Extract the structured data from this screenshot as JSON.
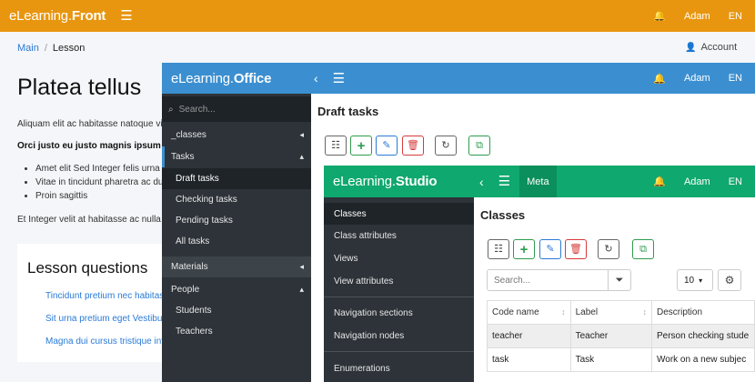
{
  "front": {
    "brand_light": "eLearning.",
    "brand_bold": "Front",
    "user": "Adam",
    "lang": "EN",
    "breadcrumb": {
      "main": "Main",
      "separator": "/",
      "current": "Lesson"
    },
    "account": "Account",
    "title": "Platea tellus",
    "paragraph1": "Aliquam elit ac habitasse natoque vi",
    "paragraph2": "Orci justo eu justo magnis ipsum ju",
    "bullets": [
      "Amet elit Sed Integer felis urna a",
      "Vitae in tincidunt pharetra ac du",
      "Proin sagittis"
    ],
    "paragraph3": "Et Integer velit at habitasse ac nulla r",
    "questions_title": "Lesson questions",
    "questions": [
      "Tincidunt pretium nec habitas",
      "Sit urna pretium eget Vestibu",
      "Magna dui cursus tristique int"
    ],
    "color": "#e8960f"
  },
  "office": {
    "brand_light": "eLearning.",
    "brand_bold": "Office",
    "user": "Adam",
    "lang": "EN",
    "search_placeholder": "Search...",
    "nav": {
      "classes": "_classes",
      "tasks": "Tasks",
      "draft_tasks": "Draft tasks",
      "checking_tasks": "Checking tasks",
      "pending_tasks": "Pending tasks",
      "all_tasks": "All tasks",
      "materials": "Materials",
      "people": "People",
      "students": "Students",
      "teachers": "Teachers"
    },
    "page_title": "Draft tasks",
    "color": "#3b8fd0"
  },
  "studio": {
    "brand_light": "eLearning.",
    "brand_bold": "Studio",
    "meta_tab": "Meta",
    "user": "Adam",
    "lang": "EN",
    "nav": {
      "classes": "Classes",
      "class_attributes": "Class attributes",
      "views": "Views",
      "view_attributes": "View attributes",
      "navigation_sections": "Navigation sections",
      "navigation_nodes": "Navigation nodes",
      "enumerations": "Enumerations"
    },
    "page_title": "Classes",
    "search_placeholder": "Search...",
    "page_size": "10",
    "columns": [
      "Code name",
      "Label",
      "Description"
    ],
    "rows": [
      [
        "teacher",
        "Teacher",
        "Person checking stude"
      ],
      [
        "task",
        "Task",
        "Work on a new subjec"
      ]
    ],
    "color": "#0fa86e"
  },
  "icons": {
    "menu": "☰",
    "bell": "🔔",
    "chevron_left": "‹",
    "caret_left": "◂",
    "caret_up": "▴",
    "list": "☷",
    "plus": "+",
    "pencil": "✎",
    "trash": "🗑",
    "refresh": "↻",
    "copy": "⧉",
    "filter": "⏷",
    "gear": "⚙",
    "person": "👤",
    "magnifier": "⌕",
    "sort": "↕",
    "dropdown": "▾"
  }
}
